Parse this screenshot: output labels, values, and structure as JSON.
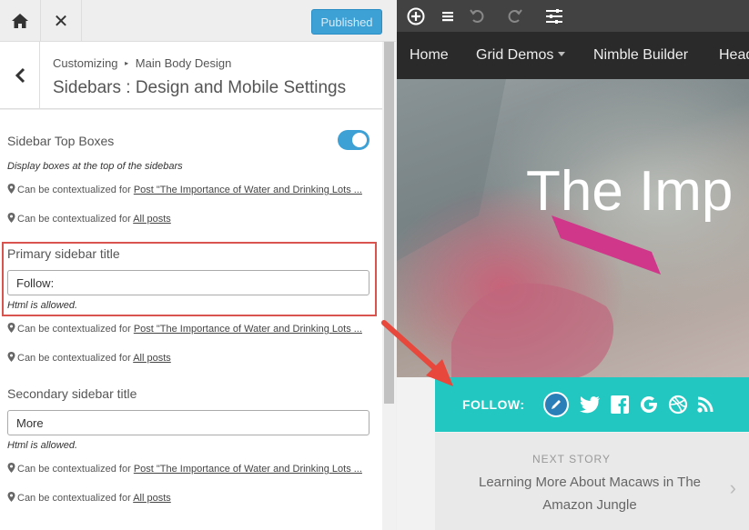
{
  "topbar": {
    "home_icon": "home-icon",
    "close_icon": "close-icon",
    "close_glyph": "✕",
    "publish_label": "Published"
  },
  "header": {
    "back_glyph": "‹",
    "breadcrumb_root": "Customizing",
    "breadcrumb_sep": "▸",
    "breadcrumb_section": "Main Body Design",
    "title": "Sidebars : Design and Mobile Settings"
  },
  "controls": {
    "top_boxes": {
      "title": "Sidebar Top Boxes",
      "enabled": true,
      "description": "Display boxes at the top of the sidebars",
      "ctx_post_prefix": "Can be contextualized for",
      "ctx_post_link": "Post \"The Importance of Water and Drinking Lots ...",
      "ctx_all_prefix": "Can be contextualized for",
      "ctx_all_link": "All posts"
    },
    "primary": {
      "title": "Primary sidebar title",
      "value": "Follow:",
      "help": "Html is allowed.",
      "ctx_post_prefix": "Can be contextualized for",
      "ctx_post_link": "Post \"The Importance of Water and Drinking Lots ...",
      "ctx_all_prefix": "Can be contextualized for",
      "ctx_all_link": "All posts"
    },
    "secondary": {
      "title": "Secondary sidebar title",
      "value": "More",
      "help": "Html is allowed.",
      "ctx_post_prefix": "Can be contextualized for",
      "ctx_post_link": "Post \"The Importance of Water and Drinking Lots ...",
      "ctx_all_prefix": "Can be contextualized for",
      "ctx_all_link": "All posts"
    }
  },
  "preview": {
    "toolbar_icons": [
      "add-icon",
      "menu-icon",
      "undo-icon",
      "redo-icon",
      "settings-sliders-icon"
    ],
    "nav": {
      "home": "Home",
      "grid_demos": "Grid Demos",
      "nimble": "Nimble Builder",
      "head": "Head"
    },
    "hero_title": "The Imp",
    "follow_label": "FOLLOW:",
    "social_icons": [
      "edit-icon",
      "twitter-icon",
      "facebook-icon",
      "google-icon",
      "dribbble-icon",
      "rss-icon"
    ],
    "next_story_label": "NEXT STORY",
    "next_story_title": "Learning More About Macaws in The Amazon Jungle",
    "next_chevron": "›"
  },
  "colors": {
    "accent_blue": "#3ea1d6",
    "follow_teal": "#22c7c2",
    "highlight_red": "#d9534f",
    "nav_dark": "#2a2a2a"
  }
}
